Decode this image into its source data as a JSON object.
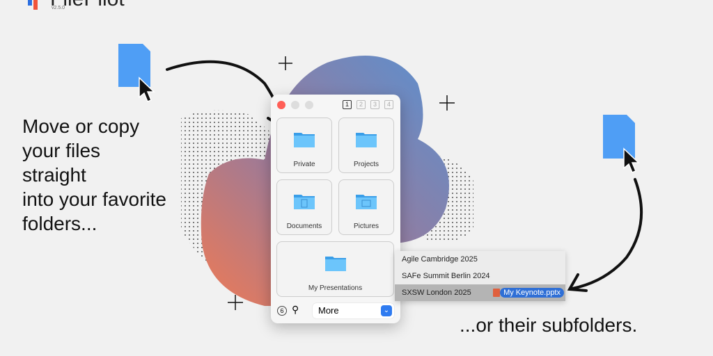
{
  "logo": {
    "name": "FilePilot",
    "version": "v2.5.0"
  },
  "headline_left": "Move or copy\nyour files\nstraight\ninto your favorite\nfolders...",
  "headline_right": "...or their subfolders.",
  "window": {
    "pages": [
      "1",
      "2",
      "3",
      "4"
    ],
    "folders": [
      {
        "label": "Private"
      },
      {
        "label": "Projects"
      },
      {
        "label": "Documents"
      },
      {
        "label": "Pictures"
      },
      {
        "label": "My Presentations"
      }
    ],
    "badge_count": "6",
    "more_select": "More"
  },
  "submenu": {
    "items": [
      "Agile Cambridge 2025",
      "SAFe Summit Berlin 2024",
      "SXSW London 2025"
    ],
    "selected_index": 2
  },
  "dragged_file": "My Keynote.pptx",
  "colors": {
    "accent": "#2f6fd6",
    "folder": "#5ab8f5",
    "close": "#ff5f57"
  }
}
